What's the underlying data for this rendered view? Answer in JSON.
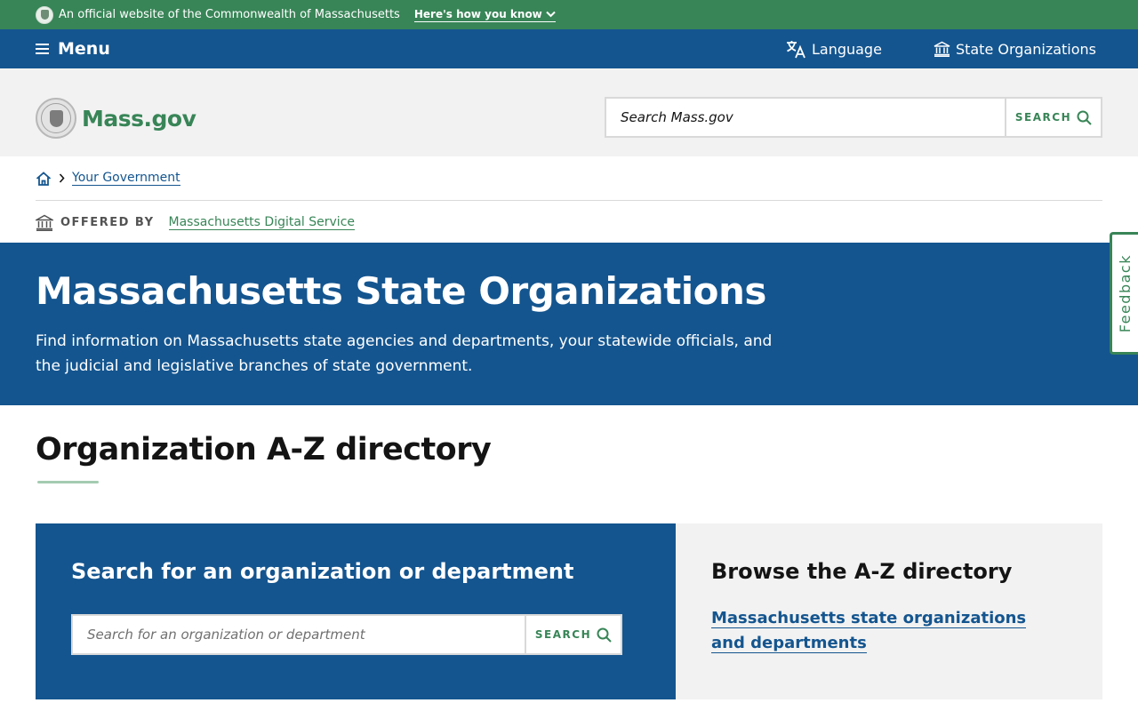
{
  "official_banner": {
    "text": "An official website of the Commonwealth of Massachusetts",
    "how_you_know": "Here's how you know"
  },
  "topnav": {
    "menu_label": "Menu",
    "language_label": "Language",
    "state_orgs_label": "State Organizations"
  },
  "header": {
    "logo_text": "Mass.gov",
    "search_placeholder": "Search Mass.gov",
    "search_button": "SEARCH"
  },
  "breadcrumb": {
    "items": [
      "Your Government"
    ]
  },
  "offered_by": {
    "label": "OFFERED BY",
    "org": "Massachusetts Digital Service"
  },
  "hero": {
    "title": "Massachusetts State Organizations",
    "description": "Find information on Massachusetts state agencies and departments, your statewide officials, and the judicial and legislative branches of state government."
  },
  "feedback": {
    "label": "Feedback"
  },
  "directory": {
    "title": "Organization A-Z directory",
    "search_panel": {
      "title": "Search for an organization or department",
      "placeholder": "Search for an organization or department",
      "button": "SEARCH"
    },
    "browse_panel": {
      "title": "Browse the A-Z directory",
      "link": "Massachusetts state organizations and departments"
    }
  },
  "colors": {
    "green": "#388557",
    "blue": "#14558f",
    "light_gray": "#f2f2f2"
  }
}
